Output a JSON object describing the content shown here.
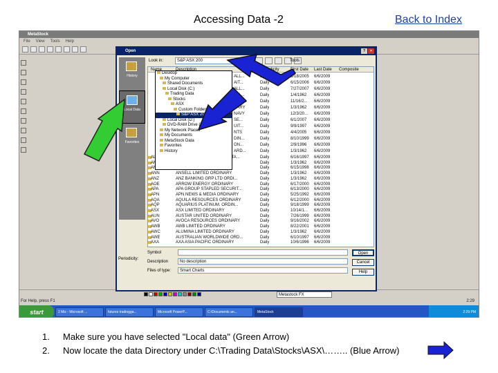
{
  "slide": {
    "title": "Accessing Data -2",
    "back_link": "Back to Index"
  },
  "app": {
    "title": "MetaStock",
    "menu": [
      "File",
      "View",
      "Tools",
      "Help"
    ],
    "status_left": "For Help, press F1",
    "ticker": "Metastock FX",
    "clock": "2:29"
  },
  "taskbar": {
    "start": "start",
    "tasks": [
      "2 Mic - Microsoft ...",
      "futures tradingga...",
      "Microsoft PowerP...",
      "C:\\Documents an...",
      "MetaStock"
    ],
    "tray_time": "2:29 PM"
  },
  "dialog": {
    "title": "Open",
    "look_in_label": "Look in:",
    "look_in_value": "S&P ASX 200",
    "tools_label": "Tools",
    "places": [
      "History",
      "Local Data",
      "Favorites"
    ],
    "columns": [
      "Name",
      "Description",
      "Periodicity",
      "First Date",
      "Last Date",
      "Composite"
    ],
    "folder_tree": [
      "Desktop",
      "My Computer",
      "Shared Documents",
      "Local Disk (C:)",
      "Trading Data",
      "Stocks",
      "ASX",
      "Custom Folders",
      "S&P ASX 200",
      "Local Disk (D:)",
      "DVD-RAM Drive (E:)",
      "My Network Places",
      "My Documents",
      "MetaStock Data",
      "Favorites",
      "History"
    ],
    "rows_top": [
      [
        "",
        "",
        "ALL...",
        "Daily",
        "8/18/2005",
        "6/6/2009"
      ],
      [
        "",
        "",
        "AIT...",
        "Daily",
        "6/15/2006",
        "6/6/2009"
      ],
      [
        "",
        "",
        "ALL...",
        "Daily",
        "7/27/2007",
        "6/6/2009"
      ],
      [
        "",
        "",
        "ALL...",
        "Daily",
        "1/4/1962",
        "6/6/2009"
      ],
      [
        "",
        "",
        "ANTI...",
        "Daily",
        "11/16/2...",
        "6/6/2009"
      ],
      [
        "",
        "",
        "DARY",
        "Daily",
        "1/3/1962",
        "6/6/2009"
      ],
      [
        "",
        "",
        "NAVY",
        "Daily",
        "12/3/20...",
        "6/6/2009"
      ],
      [
        "",
        "",
        "SE...",
        "Daily",
        "6/1/2007",
        "6/6/2009"
      ],
      [
        "",
        "",
        "UIT...",
        "Daily",
        "9/9/1997",
        "6/6/2009"
      ],
      [
        "",
        "",
        "NTS",
        "Daily",
        "4/4/2005",
        "6/6/2009"
      ],
      [
        "",
        "",
        "DIN...",
        "Daily",
        "8/10/1999",
        "6/6/2009"
      ],
      [
        "",
        "",
        "ON...",
        "Daily",
        "2/9/1996",
        "6/6/2009"
      ],
      [
        "",
        "",
        "ARD...",
        "Daily",
        "1/3/1962",
        "6/6/2009"
      ]
    ],
    "rows": [
      [
        "ALZ",
        "AUSTRALAND PROPERTY STA...",
        "Daily",
        "6/16/1997",
        "6/6/2009"
      ],
      [
        "AMC",
        "AMCOR LIMITED ORDINARY",
        "Daily",
        "1/3/1962",
        "6/6/2009"
      ],
      [
        "AMP",
        "AMP LIMITED ORDINARY",
        "Daily",
        "6/15/1998",
        "6/6/2009"
      ],
      [
        "ANN",
        "ANSELL LIMITED ORDINARY",
        "Daily",
        "1/3/1962",
        "6/6/2009"
      ],
      [
        "ANZ",
        "ANZ BANKING GRP LTD ORDI...",
        "Daily",
        "1/3/1962",
        "6/6/2009"
      ],
      [
        "AOE",
        "ARROW ENERGY ORDINARY",
        "Daily",
        "6/17/2000",
        "6/6/2009"
      ],
      [
        "APA",
        "APA GROUP STAPLED SECURIT...",
        "Daily",
        "6/13/2000",
        "6/6/2009"
      ],
      [
        "APN",
        "APN NEWS & MEDIA ORDINARY",
        "Daily",
        "5/25/1992",
        "6/6/2009"
      ],
      [
        "AQA",
        "AQUILA RESOURCES ORDINARY",
        "Daily",
        "6/12/2000",
        "6/6/2009"
      ],
      [
        "AQP",
        "AQUARIUS PLATINUM. ORDIN...",
        "Daily",
        "9/18/1999",
        "6/6/2009"
      ],
      [
        "ASX",
        "ASX LIMITED ORDINARY",
        "Daily",
        "10/14/1...",
        "6/6/2009"
      ],
      [
        "AUN",
        "AUSTAR UNITED ORDINARY",
        "Daily",
        "7/26/1999",
        "6/6/2009"
      ],
      [
        "AVO",
        "AVOCA RESOURCES ORDINARY",
        "Daily",
        "9/16/2002",
        "6/6/2009"
      ],
      [
        "AWB",
        "AWB LIMITED ORDINARY",
        "Daily",
        "8/22/2001",
        "6/6/2009"
      ],
      [
        "AWC",
        "ALUMINA LIMITED ORDINARY",
        "Daily",
        "1/3/1962",
        "6/6/2009"
      ],
      [
        "AWE",
        "AUSTRALIAN WORLDWIDE ORD...",
        "Daily",
        "6/10/1997",
        "6/6/2009"
      ],
      [
        "AXA",
        "AXA ASIA PACIFIC ORDINARY",
        "Daily",
        "10/6/1996",
        "6/6/2009"
      ]
    ],
    "symbol_label": "Symbol",
    "symbol_value": "",
    "periodicity_label": "Periodicity:",
    "description_label": "Description",
    "description_value": "No description",
    "file_type_label": "Files of type:",
    "file_type_value": "Smart Charts",
    "open_btn": "Open",
    "cancel_btn": "Cancel",
    "help_btn": "Help"
  },
  "notes": [
    {
      "num": "1.",
      "text": "Make sure you have selected \"Local data\" (Green Arrow)"
    },
    {
      "num": "2.",
      "text": "Now locate the data Directory under C:\\Trading Data\\Stocks\\ASX\\…….. (Blue Arrow)"
    }
  ],
  "colors": {
    "green_arrow": "#33cc33",
    "blue_arrow": "#1a23d4",
    "link": "#1f3f9f"
  }
}
